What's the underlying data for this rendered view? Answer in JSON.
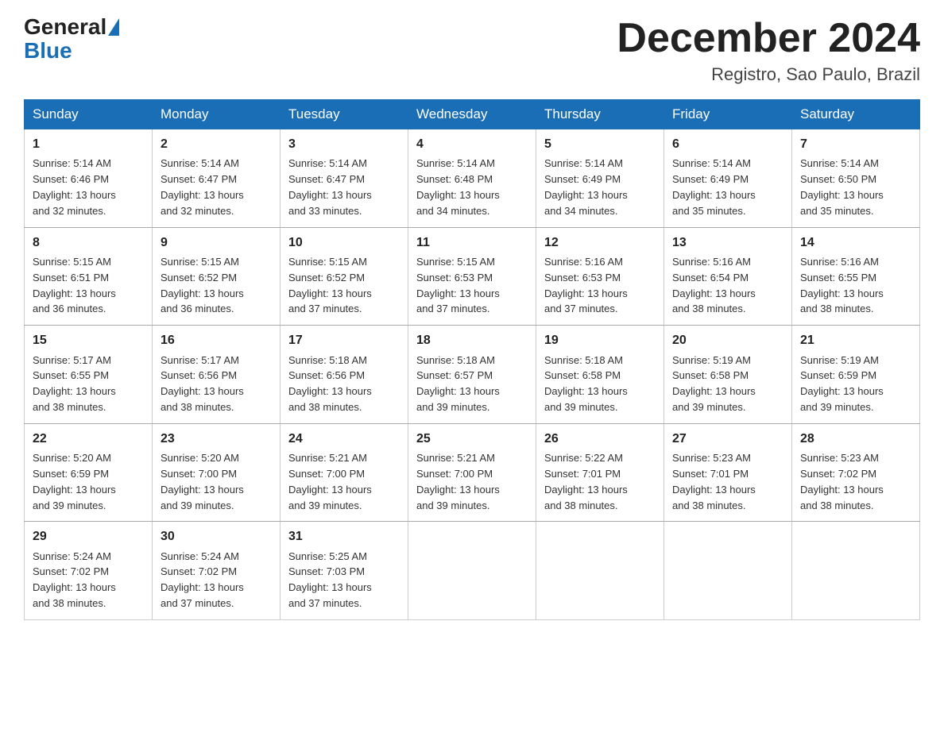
{
  "header": {
    "logo_general": "General",
    "logo_blue": "Blue",
    "month_title": "December 2024",
    "location": "Registro, Sao Paulo, Brazil"
  },
  "days_of_week": [
    "Sunday",
    "Monday",
    "Tuesday",
    "Wednesday",
    "Thursday",
    "Friday",
    "Saturday"
  ],
  "weeks": [
    [
      {
        "day": "1",
        "sunrise": "5:14 AM",
        "sunset": "6:46 PM",
        "daylight": "13 hours and 32 minutes."
      },
      {
        "day": "2",
        "sunrise": "5:14 AM",
        "sunset": "6:47 PM",
        "daylight": "13 hours and 32 minutes."
      },
      {
        "day": "3",
        "sunrise": "5:14 AM",
        "sunset": "6:47 PM",
        "daylight": "13 hours and 33 minutes."
      },
      {
        "day": "4",
        "sunrise": "5:14 AM",
        "sunset": "6:48 PM",
        "daylight": "13 hours and 34 minutes."
      },
      {
        "day": "5",
        "sunrise": "5:14 AM",
        "sunset": "6:49 PM",
        "daylight": "13 hours and 34 minutes."
      },
      {
        "day": "6",
        "sunrise": "5:14 AM",
        "sunset": "6:49 PM",
        "daylight": "13 hours and 35 minutes."
      },
      {
        "day": "7",
        "sunrise": "5:14 AM",
        "sunset": "6:50 PM",
        "daylight": "13 hours and 35 minutes."
      }
    ],
    [
      {
        "day": "8",
        "sunrise": "5:15 AM",
        "sunset": "6:51 PM",
        "daylight": "13 hours and 36 minutes."
      },
      {
        "day": "9",
        "sunrise": "5:15 AM",
        "sunset": "6:52 PM",
        "daylight": "13 hours and 36 minutes."
      },
      {
        "day": "10",
        "sunrise": "5:15 AM",
        "sunset": "6:52 PM",
        "daylight": "13 hours and 37 minutes."
      },
      {
        "day": "11",
        "sunrise": "5:15 AM",
        "sunset": "6:53 PM",
        "daylight": "13 hours and 37 minutes."
      },
      {
        "day": "12",
        "sunrise": "5:16 AM",
        "sunset": "6:53 PM",
        "daylight": "13 hours and 37 minutes."
      },
      {
        "day": "13",
        "sunrise": "5:16 AM",
        "sunset": "6:54 PM",
        "daylight": "13 hours and 38 minutes."
      },
      {
        "day": "14",
        "sunrise": "5:16 AM",
        "sunset": "6:55 PM",
        "daylight": "13 hours and 38 minutes."
      }
    ],
    [
      {
        "day": "15",
        "sunrise": "5:17 AM",
        "sunset": "6:55 PM",
        "daylight": "13 hours and 38 minutes."
      },
      {
        "day": "16",
        "sunrise": "5:17 AM",
        "sunset": "6:56 PM",
        "daylight": "13 hours and 38 minutes."
      },
      {
        "day": "17",
        "sunrise": "5:18 AM",
        "sunset": "6:56 PM",
        "daylight": "13 hours and 38 minutes."
      },
      {
        "day": "18",
        "sunrise": "5:18 AM",
        "sunset": "6:57 PM",
        "daylight": "13 hours and 39 minutes."
      },
      {
        "day": "19",
        "sunrise": "5:18 AM",
        "sunset": "6:58 PM",
        "daylight": "13 hours and 39 minutes."
      },
      {
        "day": "20",
        "sunrise": "5:19 AM",
        "sunset": "6:58 PM",
        "daylight": "13 hours and 39 minutes."
      },
      {
        "day": "21",
        "sunrise": "5:19 AM",
        "sunset": "6:59 PM",
        "daylight": "13 hours and 39 minutes."
      }
    ],
    [
      {
        "day": "22",
        "sunrise": "5:20 AM",
        "sunset": "6:59 PM",
        "daylight": "13 hours and 39 minutes."
      },
      {
        "day": "23",
        "sunrise": "5:20 AM",
        "sunset": "7:00 PM",
        "daylight": "13 hours and 39 minutes."
      },
      {
        "day": "24",
        "sunrise": "5:21 AM",
        "sunset": "7:00 PM",
        "daylight": "13 hours and 39 minutes."
      },
      {
        "day": "25",
        "sunrise": "5:21 AM",
        "sunset": "7:00 PM",
        "daylight": "13 hours and 39 minutes."
      },
      {
        "day": "26",
        "sunrise": "5:22 AM",
        "sunset": "7:01 PM",
        "daylight": "13 hours and 38 minutes."
      },
      {
        "day": "27",
        "sunrise": "5:23 AM",
        "sunset": "7:01 PM",
        "daylight": "13 hours and 38 minutes."
      },
      {
        "day": "28",
        "sunrise": "5:23 AM",
        "sunset": "7:02 PM",
        "daylight": "13 hours and 38 minutes."
      }
    ],
    [
      {
        "day": "29",
        "sunrise": "5:24 AM",
        "sunset": "7:02 PM",
        "daylight": "13 hours and 38 minutes."
      },
      {
        "day": "30",
        "sunrise": "5:24 AM",
        "sunset": "7:02 PM",
        "daylight": "13 hours and 37 minutes."
      },
      {
        "day": "31",
        "sunrise": "5:25 AM",
        "sunset": "7:03 PM",
        "daylight": "13 hours and 37 minutes."
      },
      null,
      null,
      null,
      null
    ]
  ],
  "labels": {
    "sunrise": "Sunrise:",
    "sunset": "Sunset:",
    "daylight": "Daylight:"
  }
}
